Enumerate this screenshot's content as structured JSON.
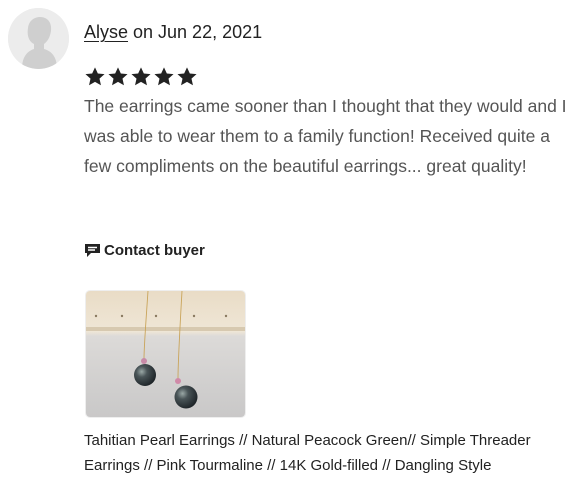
{
  "review": {
    "reviewer_name": "Alyse",
    "date_text": " on Jun 22, 2021",
    "rating": 5,
    "max_rating": 5,
    "text": "The earrings came sooner than I thought that they would and I was able to wear them to a family function! Received quite a few compliments on the beautiful earrings... great quality!",
    "contact_label": "Contact buyer"
  },
  "product": {
    "title": "Tahitian Pearl Earrings // Natural Peacock Green// Simple Threader Earrings // Pink Tourmaline // 14K Gold-filled // Dangling Style"
  },
  "colors": {
    "text": "#222222",
    "review_text": "#555555",
    "star": "#222222",
    "avatar_bg": "#ececec"
  },
  "icons": {
    "avatar": "default-user-avatar-icon",
    "star": "star-icon",
    "contact": "message-flag-icon"
  }
}
